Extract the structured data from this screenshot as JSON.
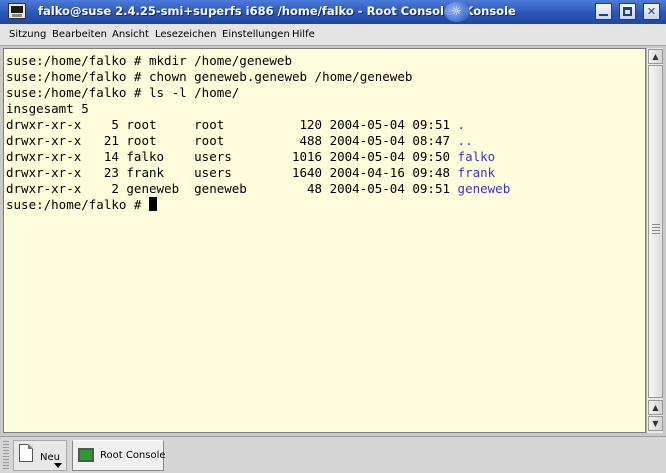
{
  "window": {
    "title": "falko@suse 2.4.25-smi+superfs i686 /home/falko - Root Console - Konsole"
  },
  "menubar": {
    "items": [
      "Sitzung",
      "Bearbeiten",
      "Ansicht",
      "Lesezeichen",
      "Einstellungen",
      "Hilfe"
    ]
  },
  "terminal": {
    "lines": [
      {
        "text": "suse:/home/falko # mkdir /home/geneweb",
        "highlight": ""
      },
      {
        "text": "suse:/home/falko # chown geneweb.geneweb /home/geneweb",
        "highlight": ""
      },
      {
        "text": "suse:/home/falko # ls -l /home/",
        "highlight": ""
      },
      {
        "text": "insgesamt 5",
        "highlight": ""
      },
      {
        "text": "drwxr-xr-x    5 root     root          120 2004-05-04 09:51 ",
        "highlight": "."
      },
      {
        "text": "drwxr-xr-x   21 root     root          488 2004-05-04 08:47 ",
        "highlight": ".."
      },
      {
        "text": "drwxr-xr-x   14 falko    users        1016 2004-05-04 09:50 ",
        "highlight": "falko"
      },
      {
        "text": "drwxr-xr-x   23 frank    users        1640 2004-04-16 09:48 ",
        "highlight": "frank"
      },
      {
        "text": "drwxr-xr-x    2 geneweb  geneweb        48 2004-05-04 09:51 ",
        "highlight": "geneweb"
      }
    ],
    "prompt": "suse:/home/falko # ",
    "highlight_color": "#3b33c8",
    "background": "#fffddc"
  },
  "taskbar": {
    "new_label": "Neu",
    "session_label": "Root Console"
  },
  "icons": {
    "app": "terminal-app-icon",
    "minimize": "minimize-icon",
    "maximize": "maximize-icon",
    "close": "close-icon"
  }
}
